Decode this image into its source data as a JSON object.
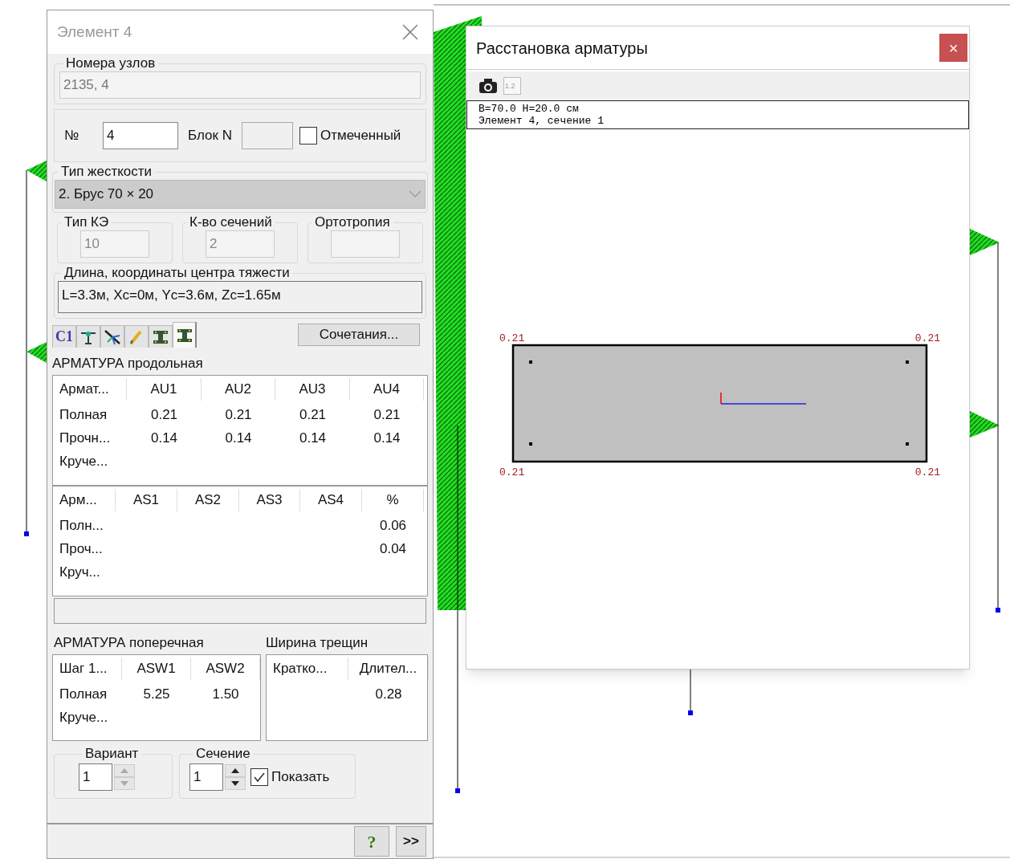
{
  "element_dialog": {
    "title": "Элемент 4",
    "nodes": {
      "label": "Номера узлов",
      "value": "2135, 4",
      "disabled": true
    },
    "number": {
      "label": "№",
      "value": "4"
    },
    "block": {
      "label": "Блок N"
    },
    "marked": {
      "label": "Отмеченный",
      "checked": false
    },
    "stiffness": {
      "label": "Тип жесткости",
      "value": "2. Брус 70 × 20"
    },
    "fe_type": {
      "label": "Тип КЭ",
      "value": "10",
      "disabled": true
    },
    "sections_count": {
      "label": "К-во сечений",
      "value": "2",
      "disabled": true
    },
    "orthotropy": {
      "label": "Ортотропия",
      "disabled": true
    },
    "length": {
      "label": "Длина, координаты центра тяжести",
      "value": "L=3.3м, Xc=0м, Yc=3.6м, Zc=1.65м"
    },
    "tabs": [
      {
        "kind": "text",
        "label": "C1",
        "selected": false
      },
      {
        "kind": "hinge",
        "selected": false
      },
      {
        "kind": "axes",
        "selected": false
      },
      {
        "kind": "pencil",
        "selected": false
      },
      {
        "kind": "beam",
        "selected": false
      },
      {
        "kind": "beam",
        "selected": true
      }
    ],
    "combinations_button": "Сочетания...",
    "longitudinal": {
      "title": "АРМАТУРА продольная",
      "table_1": {
        "columns": [
          "Армат...",
          "AU1",
          "AU2",
          "AU3",
          "AU4"
        ],
        "rows": [
          {
            "label": "Полная",
            "values": [
              "0.21",
              "0.21",
              "0.21",
              "0.21"
            ]
          },
          {
            "label": "Прочн...",
            "values": [
              "0.14",
              "0.14",
              "0.14",
              "0.14"
            ]
          },
          {
            "label": "Круче..."
          }
        ]
      },
      "table_2": {
        "columns": [
          "Арм...",
          "AS1",
          "AS2",
          "AS3",
          "AS4",
          "%"
        ],
        "rows": [
          {
            "label": "Полн...",
            "percent": "0.06"
          },
          {
            "label": "Проч...",
            "percent": "0.04"
          },
          {
            "label": "Круч..."
          }
        ]
      }
    },
    "transverse": {
      "title": "АРМАТУРА поперечная",
      "columns": [
        "Шаг 1...",
        "ASW1",
        "ASW2"
      ],
      "rows": [
        {
          "label": "Полная",
          "values": [
            "5.25",
            "1.50"
          ]
        },
        {
          "label": "Круче..."
        }
      ]
    },
    "cracks": {
      "title": "Ширина трещин",
      "columns": [
        "Кратко...",
        "Длител..."
      ],
      "rows": [
        {
          "long": "0.28"
        }
      ]
    },
    "variant": {
      "label": "Вариант",
      "value": "1",
      "disabled": true
    },
    "section": {
      "label": "Сечение",
      "value": "1",
      "disabled": false
    },
    "show": {
      "label": "Показать",
      "checked": true
    },
    "buttons": [
      "?",
      ">>"
    ]
  },
  "reinforcement_window": {
    "title": "Расстановка арматуры",
    "close": "×",
    "toolbar": [
      {
        "kind": "camera"
      },
      {
        "kind": "document",
        "label": "1.2"
      }
    ],
    "info_lines": [
      "B=70.0 H=20.0 см",
      "Элемент 4, сечение 1"
    ],
    "corner_labels": [
      "0.21",
      "0.21",
      "0.21",
      "0.21"
    ]
  }
}
